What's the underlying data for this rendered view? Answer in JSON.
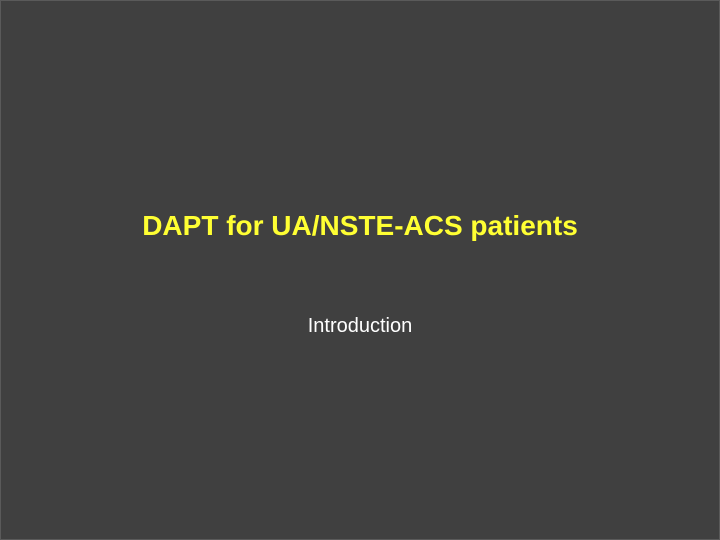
{
  "slide": {
    "title": "DAPT for UA/NSTE-ACS patients",
    "subtitle": "Introduction"
  },
  "colors": {
    "background": "#404040",
    "title": "#ffff33",
    "subtitle": "#ffffff"
  }
}
